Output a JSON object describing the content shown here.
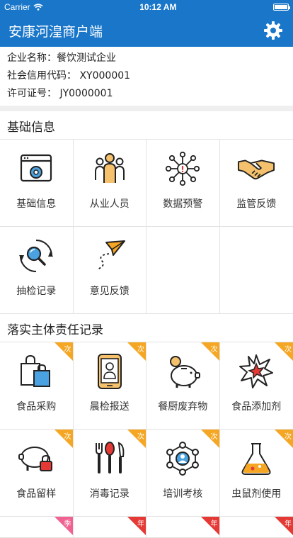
{
  "status": {
    "carrier": "Carrier",
    "time": "10:12 AM",
    "battery_level": 1.0
  },
  "header": {
    "title": "安康河湟商户端",
    "settings_icon": "gear-icon"
  },
  "company": {
    "name_line": "企业名称：餐饮测试企业",
    "credit_line": "社会信用代码： XY000001",
    "license_line": "许可证号： JY0000001"
  },
  "basic": {
    "section_title": "基础信息",
    "items": [
      {
        "label": "基础信息",
        "icon": "settings-window-icon"
      },
      {
        "label": "从业人员",
        "icon": "staff-icon"
      },
      {
        "label": "数据预警",
        "icon": "alert-network-icon"
      },
      {
        "label": "监管反馈",
        "icon": "handshake-icon"
      },
      {
        "label": "抽检记录",
        "icon": "inspection-search-icon"
      },
      {
        "label": "意见反馈",
        "icon": "paper-plane-icon"
      }
    ]
  },
  "records": {
    "section_title": "落实主体责任记录",
    "items": [
      {
        "label": "食品采购",
        "icon": "shopping-bag-icon",
        "badge": "次"
      },
      {
        "label": "晨检报送",
        "icon": "phone-person-icon",
        "badge": "次"
      },
      {
        "label": "餐厨废弃物",
        "icon": "piggy-bank-icon",
        "badge": "次"
      },
      {
        "label": "食品添加剂",
        "icon": "burst-icon",
        "badge": "次"
      },
      {
        "label": "食品留样",
        "icon": "pig-lock-icon",
        "badge": "次"
      },
      {
        "label": "消毒记录",
        "icon": "cutlery-icon",
        "badge": "次"
      },
      {
        "label": "培训考核",
        "icon": "training-network-icon",
        "badge": "次"
      },
      {
        "label": "虫鼠剂使用",
        "icon": "flask-icon",
        "badge": "次"
      }
    ],
    "next_badges": [
      "季",
      "年",
      "年",
      "年"
    ]
  },
  "colors": {
    "primary": "#1976c9",
    "badge_orange": "#f5a623",
    "badge_pink": "#f06292",
    "badge_red": "#e53935"
  }
}
